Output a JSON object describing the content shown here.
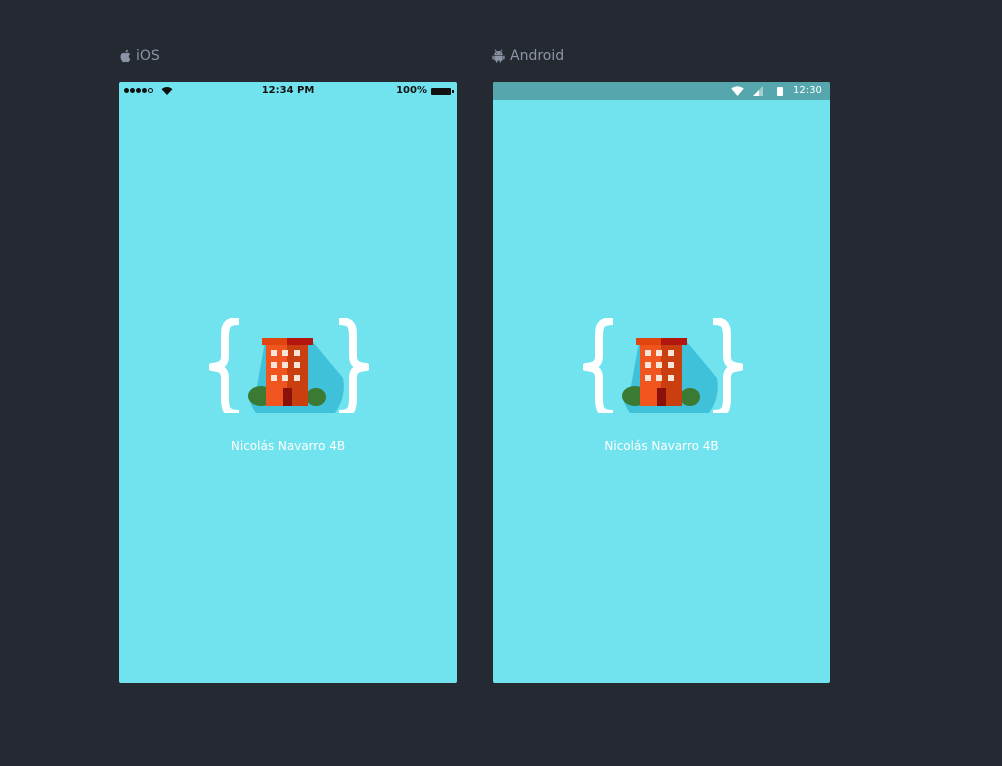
{
  "platforms": {
    "ios": {
      "label": "iOS",
      "icon": "apple-icon",
      "status_bar": {
        "time": "12:34 PM",
        "battery": "100%"
      },
      "app_name": "Nicolás Navarro 4B"
    },
    "android": {
      "label": "Android",
      "icon": "android-icon",
      "status_bar": {
        "time": "12:30"
      },
      "app_name": "Nicolás Navarro 4B"
    }
  },
  "colors": {
    "background": "#252a32",
    "splash": "#71e3ef",
    "android_status_bar": "#55a6ad",
    "label": "#8c95a6",
    "logo_braces": "#ffffff",
    "building_orange": "#f0541f",
    "building_dark": "#c93f10",
    "roof": "#b3160c",
    "bush": "#3b7a32",
    "shadow": "#3fc2d9"
  }
}
